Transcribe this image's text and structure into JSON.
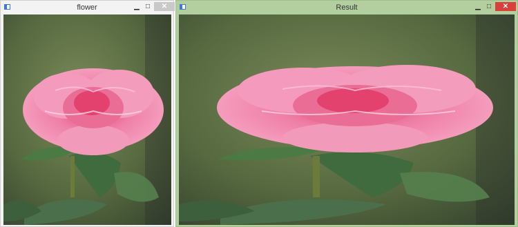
{
  "windows": {
    "left": {
      "title": "flower",
      "minimize": "▁",
      "maximize": "□",
      "close": "✕"
    },
    "right": {
      "title": "Result",
      "minimize": "▁",
      "maximize": "□",
      "close": "✕"
    }
  },
  "icons": {
    "app": "window-app-icon"
  },
  "colors": {
    "background_blur": "#5f7146",
    "petal_light": "#f7a9c5",
    "petal_mid": "#ef7fa6",
    "petal_deep": "#e3426f",
    "leaf": "#3f6b3f",
    "close_active": "#d9403a"
  }
}
